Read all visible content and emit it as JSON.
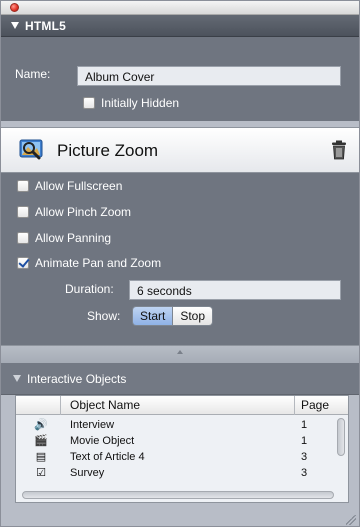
{
  "htmls_section": {
    "title": "HTML5",
    "name_label": "Name:",
    "name_value": "Album Cover",
    "initially_hidden_label": "Initially Hidden",
    "initially_hidden_checked": false
  },
  "picture_zoom": {
    "title": "Picture Zoom",
    "icon": "magnifier-picture-icon",
    "delete_icon": "trash-icon",
    "options": [
      {
        "label": "Allow Fullscreen",
        "checked": false
      },
      {
        "label": "Allow Pinch Zoom",
        "checked": false
      },
      {
        "label": "Allow Panning",
        "checked": false
      },
      {
        "label": "Animate Pan and Zoom",
        "checked": true
      }
    ],
    "duration_label": "Duration:",
    "duration_value": "6 seconds",
    "show_label": "Show:",
    "show_buttons": [
      "Start",
      "Stop"
    ],
    "show_selected": "Start"
  },
  "interactive_objects": {
    "title": "Interactive Objects",
    "columns": [
      "Object Name",
      "Page"
    ],
    "rows": [
      {
        "icon": "speaker-icon",
        "glyph": "🔊",
        "name": "Interview",
        "page": "1"
      },
      {
        "icon": "movie-clapper-icon",
        "glyph": "🎬",
        "name": "Movie Object",
        "page": "1"
      },
      {
        "icon": "text-article-icon",
        "glyph": "▤",
        "name": "Text of Article 4",
        "page": "3"
      },
      {
        "icon": "survey-icon",
        "glyph": "☑",
        "name": "Survey",
        "page": "3"
      }
    ]
  },
  "colors": {
    "panel_bg": "#6f7580",
    "header_bg": "#4c525c",
    "selected_segment": "#8fb2e6",
    "close_button": "#e5372a"
  }
}
